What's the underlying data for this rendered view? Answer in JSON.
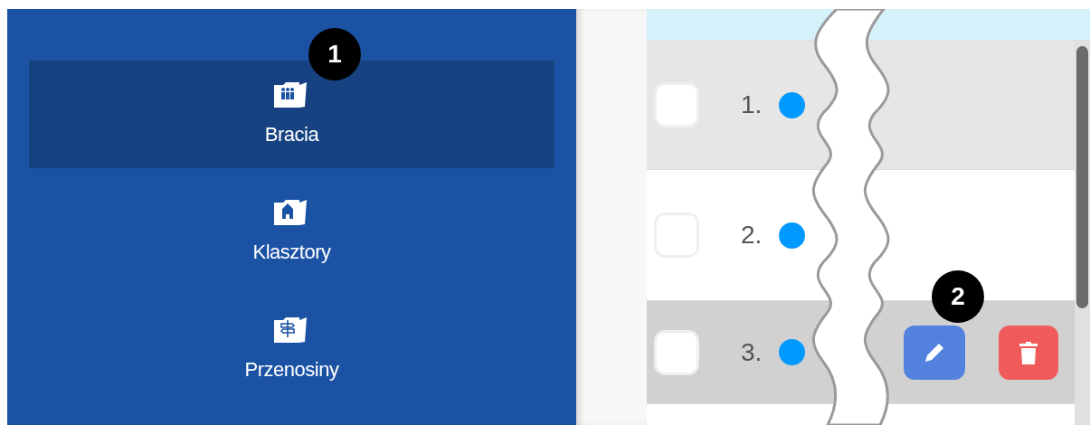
{
  "sidebar": {
    "items": [
      {
        "label": "Bracia",
        "kind": "people",
        "selected": true
      },
      {
        "label": "Klasztory",
        "kind": "building",
        "selected": false
      },
      {
        "label": "Przenosiny",
        "kind": "signpost",
        "selected": false
      }
    ]
  },
  "table": {
    "rows": [
      {
        "number": "1.",
        "checked": false,
        "color": "#0099ff",
        "highlighted": false
      },
      {
        "number": "2.",
        "checked": false,
        "color": "#0099ff",
        "highlighted": false
      },
      {
        "number": "3.",
        "checked": false,
        "color": "#0099ff",
        "highlighted": true
      }
    ]
  },
  "callouts": [
    "1",
    "2"
  ]
}
